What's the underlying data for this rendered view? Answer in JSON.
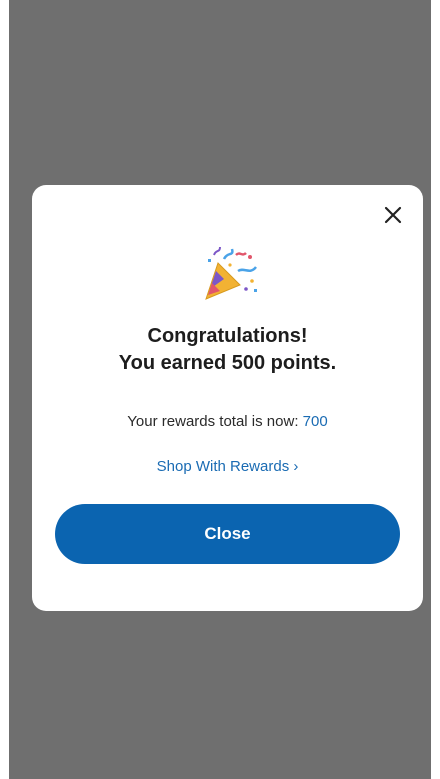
{
  "modal": {
    "title_line1": "Congratulations!",
    "title_line2": "You earned 500 points.",
    "rewards_prefix": "Your rewards total is now:",
    "rewards_value": "700",
    "shop_link": "Shop With Rewards ›",
    "close_button": "Close",
    "close_icon": "close-icon",
    "celebration_icon": "party-popper-icon"
  },
  "colors": {
    "overlay": "#6f6f6f",
    "accent": "#0b64b0",
    "link": "#1a6bb3"
  }
}
